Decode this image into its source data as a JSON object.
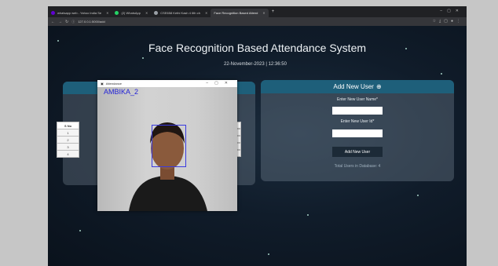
{
  "browser": {
    "tabs": [
      {
        "label": "whatsapp web - Yahoo India Se",
        "icon": "yahoo-icon",
        "color": "#6001d2"
      },
      {
        "label": "(2) WhatsApp",
        "icon": "whatsapp-icon",
        "color": "#25d366"
      },
      {
        "label": "CSE658 Kethi Kash 4 6th ch",
        "icon": "globe-icon",
        "color": "#9aa0a6"
      },
      {
        "label": "Face Recognition Based Attend",
        "icon": "globe-icon",
        "color": "#9aa0a6",
        "active": true
      }
    ],
    "url": "127.0.0.1:5000/add"
  },
  "page": {
    "title": "Face Recognition Based Attendance System",
    "datetime": "22-November-2023 | 12:36:50",
    "attendance_table": {
      "headers": [
        "S No"
      ],
      "rows": [
        "1",
        "2",
        "3",
        "4"
      ]
    },
    "add_user": {
      "title": "Add New User",
      "icon": "user-add-icon",
      "name_label": "Enter New User Name*",
      "id_label": "Enter New User Id*",
      "name_value": "",
      "id_value": "",
      "button_label": "Add New User",
      "total_users": "Total Users in Database: 4"
    }
  },
  "camera_window": {
    "title": "Attendance",
    "recognized_name": "AMBIKA_2"
  },
  "colors": {
    "card_header": "#1e5f7a",
    "page_background": "#101c2a",
    "face_box": "#3a3ae0",
    "name_text": "#2424d6"
  }
}
